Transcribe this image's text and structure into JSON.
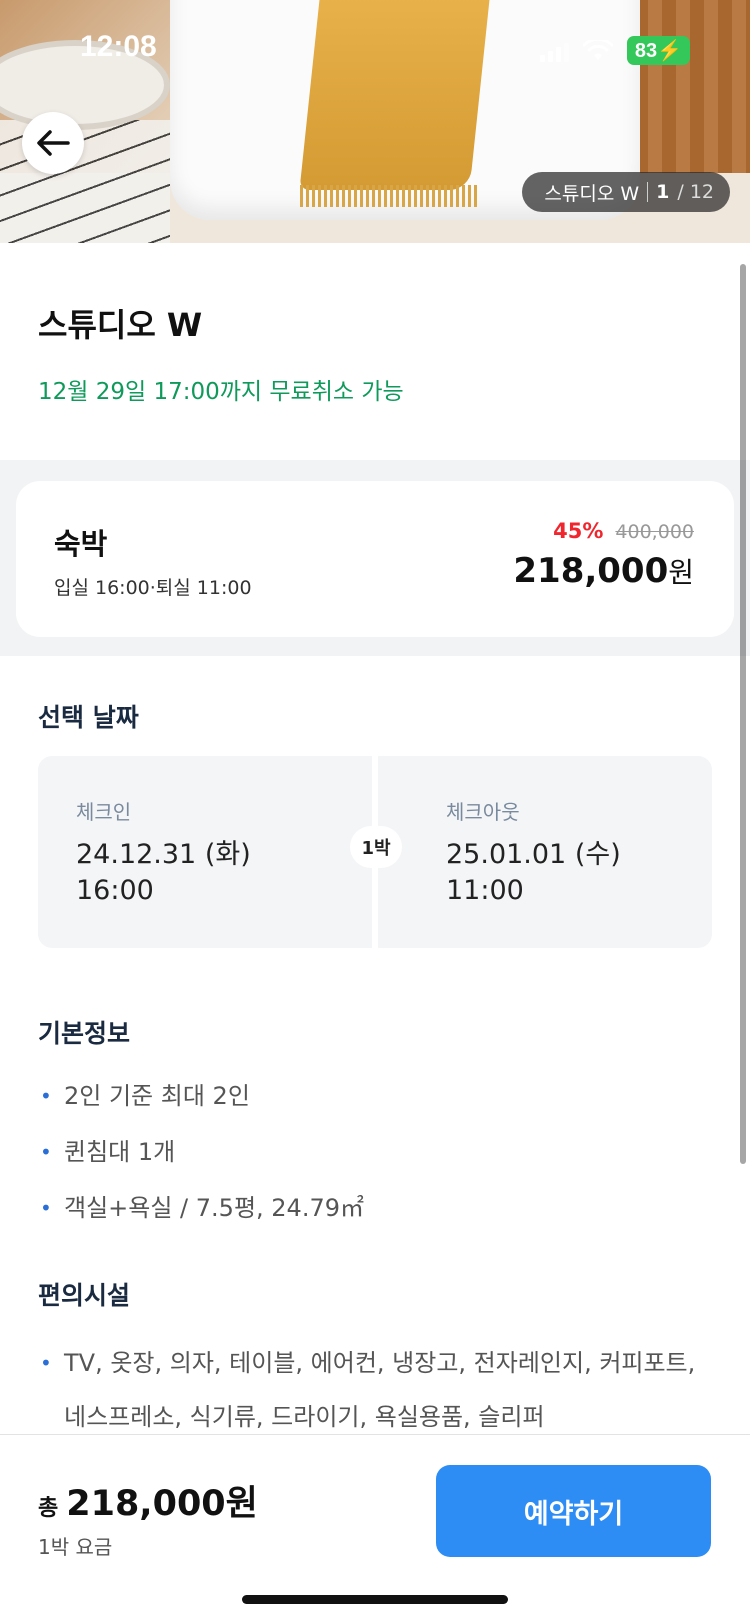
{
  "status_bar": {
    "time": "12:08",
    "battery": "83"
  },
  "hero": {
    "room_label": "스튜디오 W",
    "photo_index": "1",
    "photo_total": "12"
  },
  "room": {
    "title": "스튜디오 W",
    "cancel_policy": "12월 29일 17:00까지 무료취소 가능"
  },
  "price_card": {
    "stay_type": "숙박",
    "stay_times": "입실 16:00·퇴실 11:00",
    "discount": "45%",
    "original_price": "400,000",
    "sale_price": "218,000",
    "currency": "원"
  },
  "dates": {
    "section_title": "선택 날짜",
    "checkin_label": "체크인",
    "checkin_date": "24.12.31 (화)",
    "checkin_time": "16:00",
    "nights": "1박",
    "checkout_label": "체크아웃",
    "checkout_date": "25.01.01 (수)",
    "checkout_time": "11:00"
  },
  "basic_info": {
    "section_title": "기본정보",
    "items": [
      "2인 기준 최대 2인",
      "퀸침대 1개",
      "객실+욕실 / 7.5평, 24.79㎡"
    ]
  },
  "amenities": {
    "section_title": "편의시설",
    "text": "TV, 옷장, 의자, 테이블, 에어컨, 냉장고, 전자레인지, 커피포트, 네스프레소, 식기류, 드라이기, 욕실용품, 슬리퍼"
  },
  "bottom": {
    "total_prefix": "총",
    "total_amount": "218,000원",
    "per_night": "1박 요금",
    "book_label": "예약하기"
  },
  "colors": {
    "accent": "#2e8cf5",
    "cancel_green": "#0f9a5b",
    "discount_red": "#f0262f"
  }
}
